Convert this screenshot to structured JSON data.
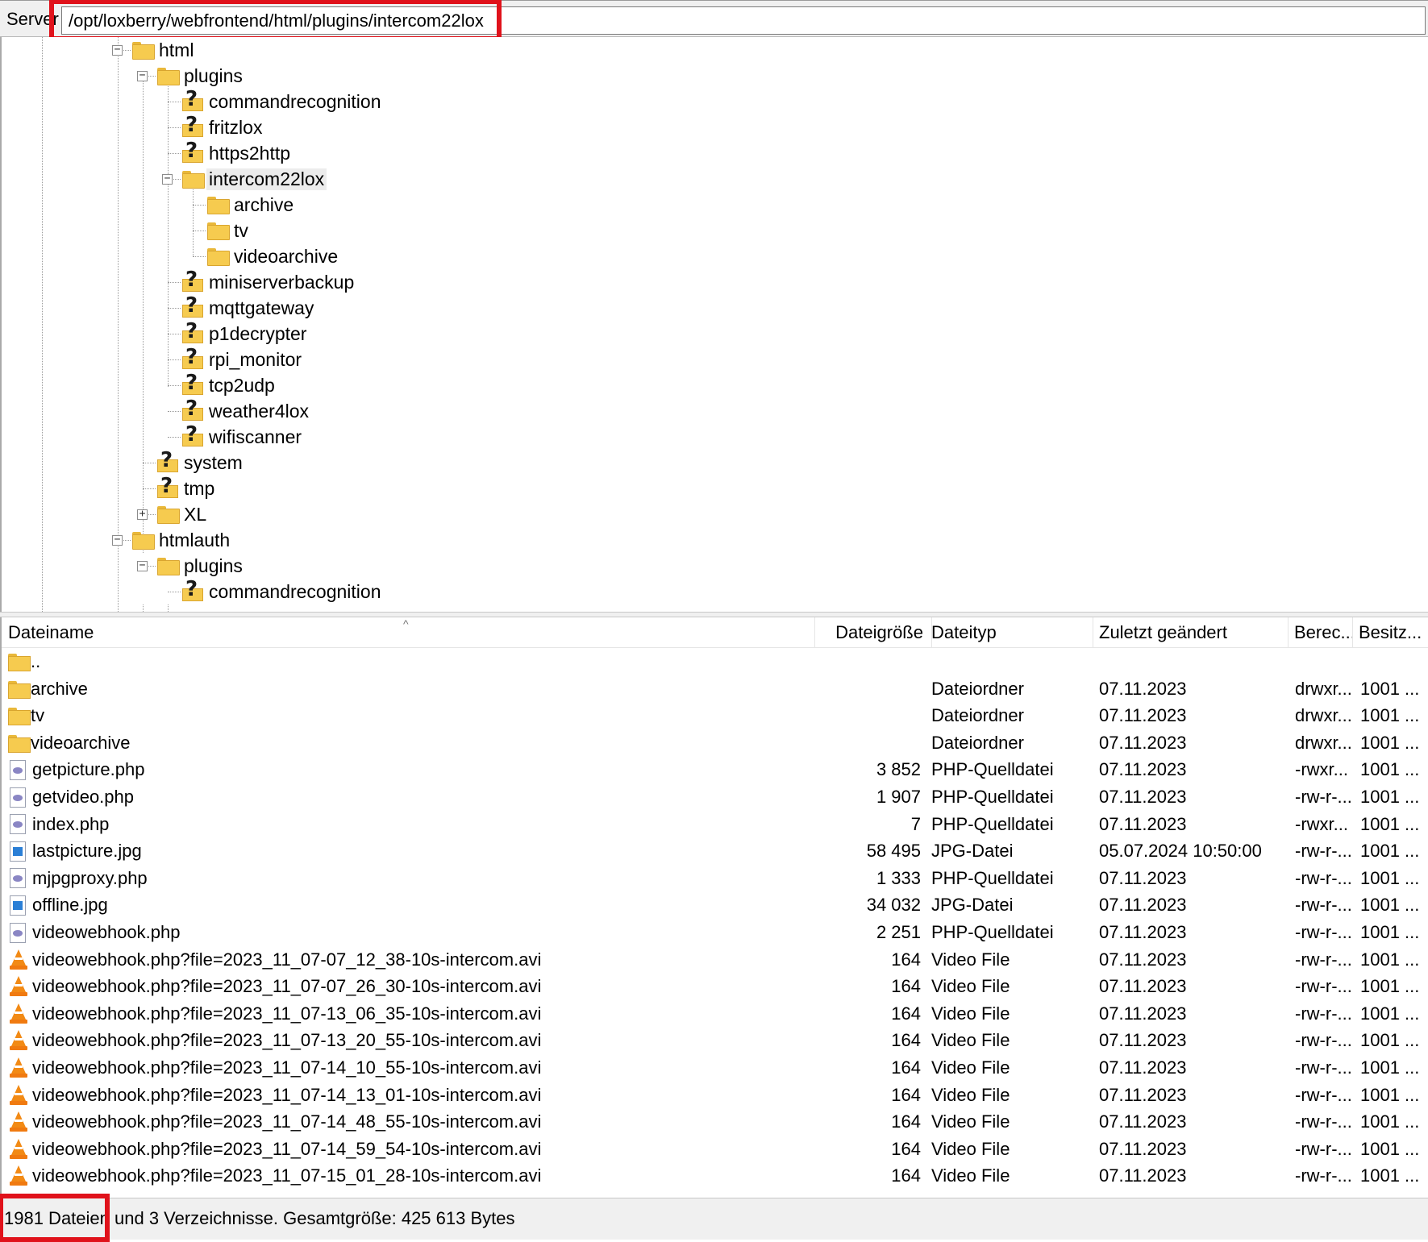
{
  "path_bar": {
    "label": "Server",
    "path": "/opt/loxberry/webfrontend/html/plugins/intercom22lox",
    "highlight_color": "#e0121b"
  },
  "tree": {
    "nodes": [
      {
        "label": "html",
        "icon": "folder-icon",
        "expander": "minus"
      },
      {
        "label": "plugins",
        "icon": "folder-icon",
        "expander": "minus"
      },
      {
        "label": "commandrecognition",
        "icon": "unknown-folder-icon"
      },
      {
        "label": "fritzlox",
        "icon": "unknown-folder-icon"
      },
      {
        "label": "https2http",
        "icon": "unknown-folder-icon"
      },
      {
        "label": "intercom22lox",
        "icon": "folder-icon",
        "expander": "minus",
        "selected": true
      },
      {
        "label": "archive",
        "icon": "folder-icon"
      },
      {
        "label": "tv",
        "icon": "folder-icon"
      },
      {
        "label": "videoarchive",
        "icon": "folder-icon"
      },
      {
        "label": "miniserverbackup",
        "icon": "unknown-folder-icon"
      },
      {
        "label": "mqttgateway",
        "icon": "unknown-folder-icon"
      },
      {
        "label": "p1decrypter",
        "icon": "unknown-folder-icon"
      },
      {
        "label": "rpi_monitor",
        "icon": "unknown-folder-icon"
      },
      {
        "label": "tcp2udp",
        "icon": "unknown-folder-icon"
      },
      {
        "label": "weather4lox",
        "icon": "unknown-folder-icon"
      },
      {
        "label": "wifiscanner",
        "icon": "unknown-folder-icon"
      },
      {
        "label": "system",
        "icon": "unknown-folder-icon"
      },
      {
        "label": "tmp",
        "icon": "unknown-folder-icon"
      },
      {
        "label": "XL",
        "icon": "folder-icon",
        "expander": "plus"
      },
      {
        "label": "htmlauth",
        "icon": "folder-icon",
        "expander": "minus"
      },
      {
        "label": "plugins",
        "icon": "folder-icon",
        "expander": "minus"
      },
      {
        "label": "commandrecognition",
        "icon": "unknown-folder-icon"
      }
    ]
  },
  "file_list": {
    "columns": {
      "name": "Dateiname",
      "size": "Dateigröße",
      "type": "Dateityp",
      "modified": "Zuletzt geändert",
      "permissions": "Berec...",
      "owner": "Besitz..."
    },
    "rows": [
      {
        "name": "..",
        "icon": "folder-icon",
        "size": "",
        "type": "",
        "modified": "",
        "permissions": "",
        "owner": ""
      },
      {
        "name": "archive",
        "icon": "folder-icon",
        "size": "",
        "type": "Dateiordner",
        "modified": "07.11.2023",
        "permissions": "drwxr...",
        "owner": "1001 ..."
      },
      {
        "name": "tv",
        "icon": "folder-icon",
        "size": "",
        "type": "Dateiordner",
        "modified": "07.11.2023",
        "permissions": "drwxr...",
        "owner": "1001 ..."
      },
      {
        "name": "videoarchive",
        "icon": "folder-icon",
        "size": "",
        "type": "Dateiordner",
        "modified": "07.11.2023",
        "permissions": "drwxr...",
        "owner": "1001 ..."
      },
      {
        "name": "getpicture.php",
        "icon": "php-file-icon",
        "size": "3 852",
        "type": "PHP-Quelldatei",
        "modified": "07.11.2023",
        "permissions": "-rwxr...",
        "owner": "1001 ..."
      },
      {
        "name": "getvideo.php",
        "icon": "php-file-icon",
        "size": "1 907",
        "type": "PHP-Quelldatei",
        "modified": "07.11.2023",
        "permissions": "-rw-r-...",
        "owner": "1001 ..."
      },
      {
        "name": "index.php",
        "icon": "php-file-icon",
        "size": "7",
        "type": "PHP-Quelldatei",
        "modified": "07.11.2023",
        "permissions": "-rwxr...",
        "owner": "1001 ..."
      },
      {
        "name": "lastpicture.jpg",
        "icon": "jpg-file-icon",
        "size": "58 495",
        "type": "JPG-Datei",
        "modified": "05.07.2024 10:50:00",
        "permissions": "-rw-r-...",
        "owner": "1001 ..."
      },
      {
        "name": "mjpgproxy.php",
        "icon": "php-file-icon",
        "size": "1 333",
        "type": "PHP-Quelldatei",
        "modified": "07.11.2023",
        "permissions": "-rw-r-...",
        "owner": "1001 ..."
      },
      {
        "name": "offline.jpg",
        "icon": "jpg-file-icon",
        "size": "34 032",
        "type": "JPG-Datei",
        "modified": "07.11.2023",
        "permissions": "-rw-r-...",
        "owner": "1001 ..."
      },
      {
        "name": "videowebhook.php",
        "icon": "php-file-icon",
        "size": "2 251",
        "type": "PHP-Quelldatei",
        "modified": "07.11.2023",
        "permissions": "-rw-r-...",
        "owner": "1001 ..."
      },
      {
        "name": "videowebhook.php?file=2023_11_07-07_12_38-10s-intercom.avi",
        "icon": "vlc-cone-icon",
        "size": "164",
        "type": "Video File",
        "modified": "07.11.2023",
        "permissions": "-rw-r-...",
        "owner": "1001 ..."
      },
      {
        "name": "videowebhook.php?file=2023_11_07-07_26_30-10s-intercom.avi",
        "icon": "vlc-cone-icon",
        "size": "164",
        "type": "Video File",
        "modified": "07.11.2023",
        "permissions": "-rw-r-...",
        "owner": "1001 ..."
      },
      {
        "name": "videowebhook.php?file=2023_11_07-13_06_35-10s-intercom.avi",
        "icon": "vlc-cone-icon",
        "size": "164",
        "type": "Video File",
        "modified": "07.11.2023",
        "permissions": "-rw-r-...",
        "owner": "1001 ..."
      },
      {
        "name": "videowebhook.php?file=2023_11_07-13_20_55-10s-intercom.avi",
        "icon": "vlc-cone-icon",
        "size": "164",
        "type": "Video File",
        "modified": "07.11.2023",
        "permissions": "-rw-r-...",
        "owner": "1001 ..."
      },
      {
        "name": "videowebhook.php?file=2023_11_07-14_10_55-10s-intercom.avi",
        "icon": "vlc-cone-icon",
        "size": "164",
        "type": "Video File",
        "modified": "07.11.2023",
        "permissions": "-rw-r-...",
        "owner": "1001 ..."
      },
      {
        "name": "videowebhook.php?file=2023_11_07-14_13_01-10s-intercom.avi",
        "icon": "vlc-cone-icon",
        "size": "164",
        "type": "Video File",
        "modified": "07.11.2023",
        "permissions": "-rw-r-...",
        "owner": "1001 ..."
      },
      {
        "name": "videowebhook.php?file=2023_11_07-14_48_55-10s-intercom.avi",
        "icon": "vlc-cone-icon",
        "size": "164",
        "type": "Video File",
        "modified": "07.11.2023",
        "permissions": "-rw-r-...",
        "owner": "1001 ..."
      },
      {
        "name": "videowebhook.php?file=2023_11_07-14_59_54-10s-intercom.avi",
        "icon": "vlc-cone-icon",
        "size": "164",
        "type": "Video File",
        "modified": "07.11.2023",
        "permissions": "-rw-r-...",
        "owner": "1001 ..."
      },
      {
        "name": "videowebhook.php?file=2023_11_07-15_01_28-10s-intercom.avi",
        "icon": "vlc-cone-icon",
        "size": "164",
        "type": "Video File",
        "modified": "07.11.2023",
        "permissions": "-rw-r-...",
        "owner": "1001 ..."
      }
    ]
  },
  "status_bar": {
    "text": "1981 Dateien und 3 Verzeichnisse. Gesamtgröße: 425 613 Bytes"
  }
}
